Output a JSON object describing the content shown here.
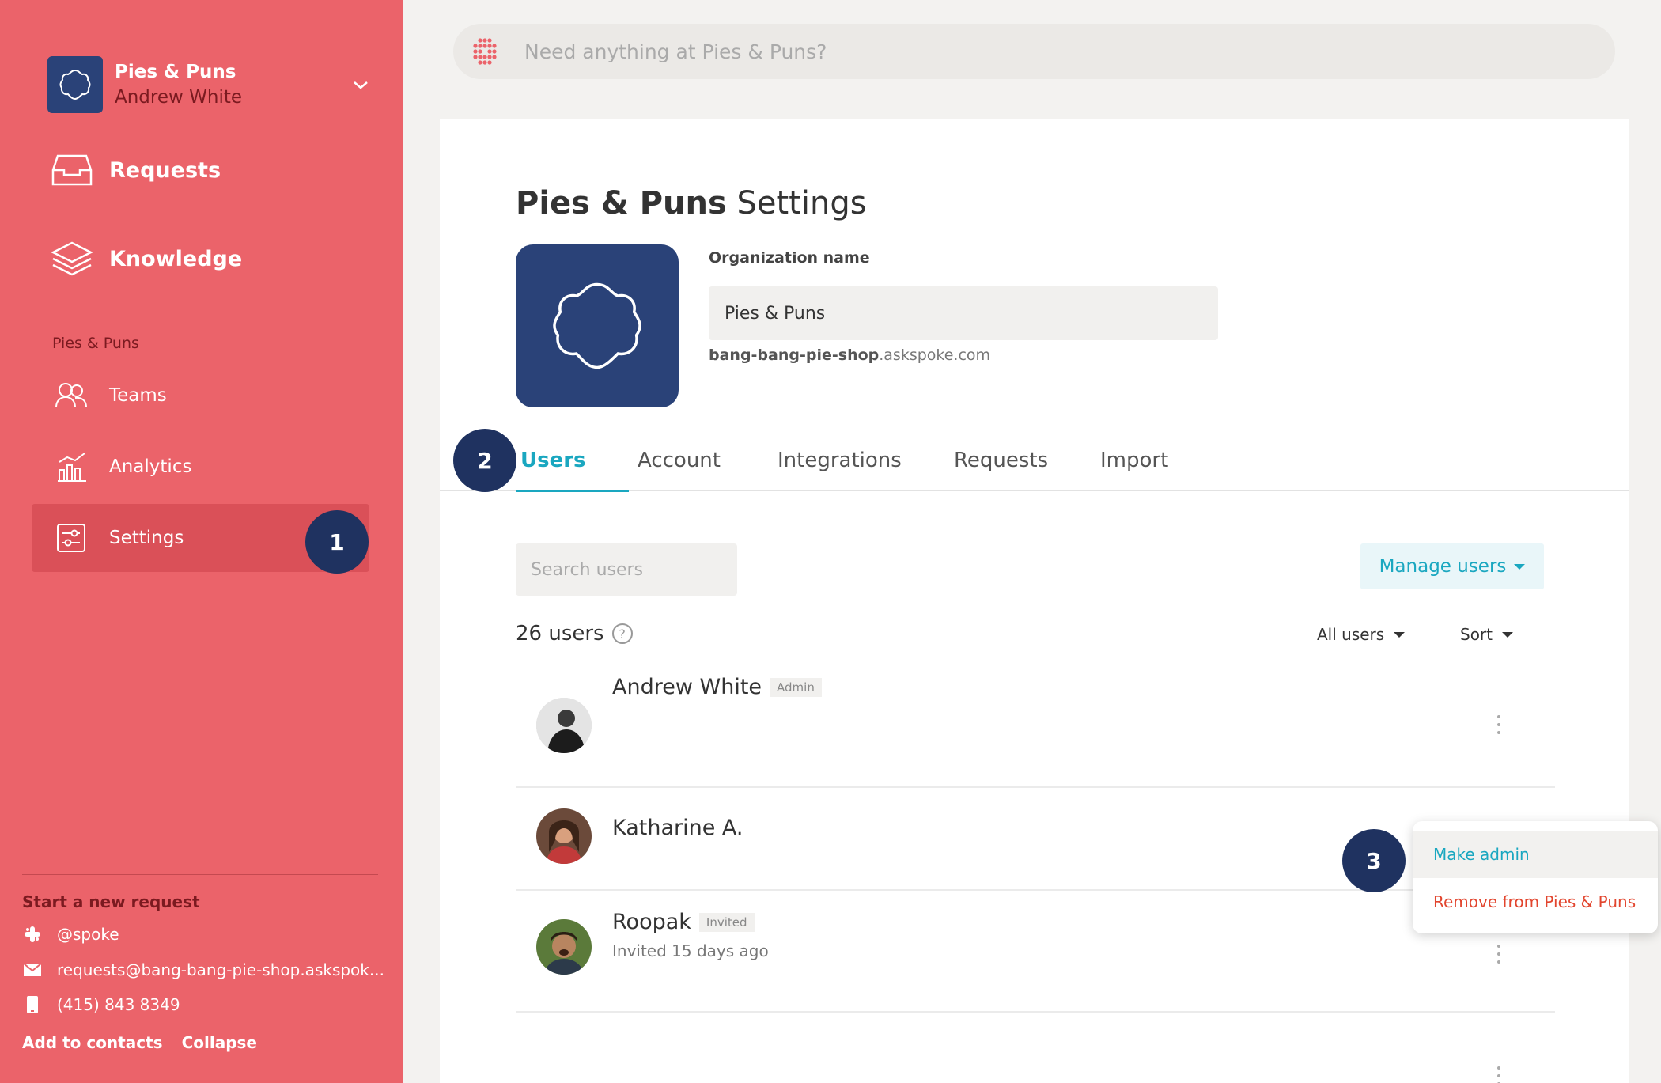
{
  "sidebar": {
    "org_name": "Pies & Puns",
    "user_name": "Andrew White",
    "nav_main": [
      {
        "label": "Requests",
        "icon": "inbox-icon"
      },
      {
        "label": "Knowledge",
        "icon": "layers-icon"
      }
    ],
    "section_label": "Pies & Puns",
    "nav_org": [
      {
        "label": "Teams",
        "icon": "users-icon"
      },
      {
        "label": "Analytics",
        "icon": "analytics-icon"
      },
      {
        "label": "Settings",
        "icon": "settings-icon",
        "active": true
      }
    ],
    "footer": {
      "title": "Start a new request",
      "slack": "@spoke",
      "email": "requests@bang-bang-pie-shop.askspok...",
      "phone": "(415) 843 8349",
      "add_contacts": "Add to contacts",
      "collapse": "Collapse"
    }
  },
  "badges": [
    "1",
    "2",
    "3"
  ],
  "search": {
    "placeholder": "Need anything at Pies & Puns?"
  },
  "settings": {
    "title_bold": "Pies & Puns",
    "title_rest": " Settings",
    "org_label": "Organization name",
    "org_value": "Pies & Puns",
    "subdomain": "bang-bang-pie-shop",
    "domain_suffix": ".askspoke.com",
    "tabs": [
      "Users",
      "Account",
      "Integrations",
      "Requests",
      "Import"
    ],
    "active_tab": "Users"
  },
  "users": {
    "search_placeholder": "Search users",
    "manage_label": "Manage users",
    "count_label": "26 users",
    "help": "?",
    "filter_label": "All users",
    "sort_label": "Sort",
    "rows": [
      {
        "name": "Andrew White",
        "tag": "Admin",
        "sub": ""
      },
      {
        "name": "Katharine A.",
        "tag": "",
        "sub": ""
      },
      {
        "name": "Roopak",
        "tag": "Invited",
        "sub": "Invited 15 days ago"
      }
    ]
  },
  "menu": {
    "items": [
      "Make admin",
      "Remove from Pies & Puns"
    ]
  },
  "colors": {
    "sidebar": "#eb636a",
    "brand_navy": "#2a4278",
    "accent_teal": "#1aa7c0",
    "danger": "#e2452e"
  }
}
